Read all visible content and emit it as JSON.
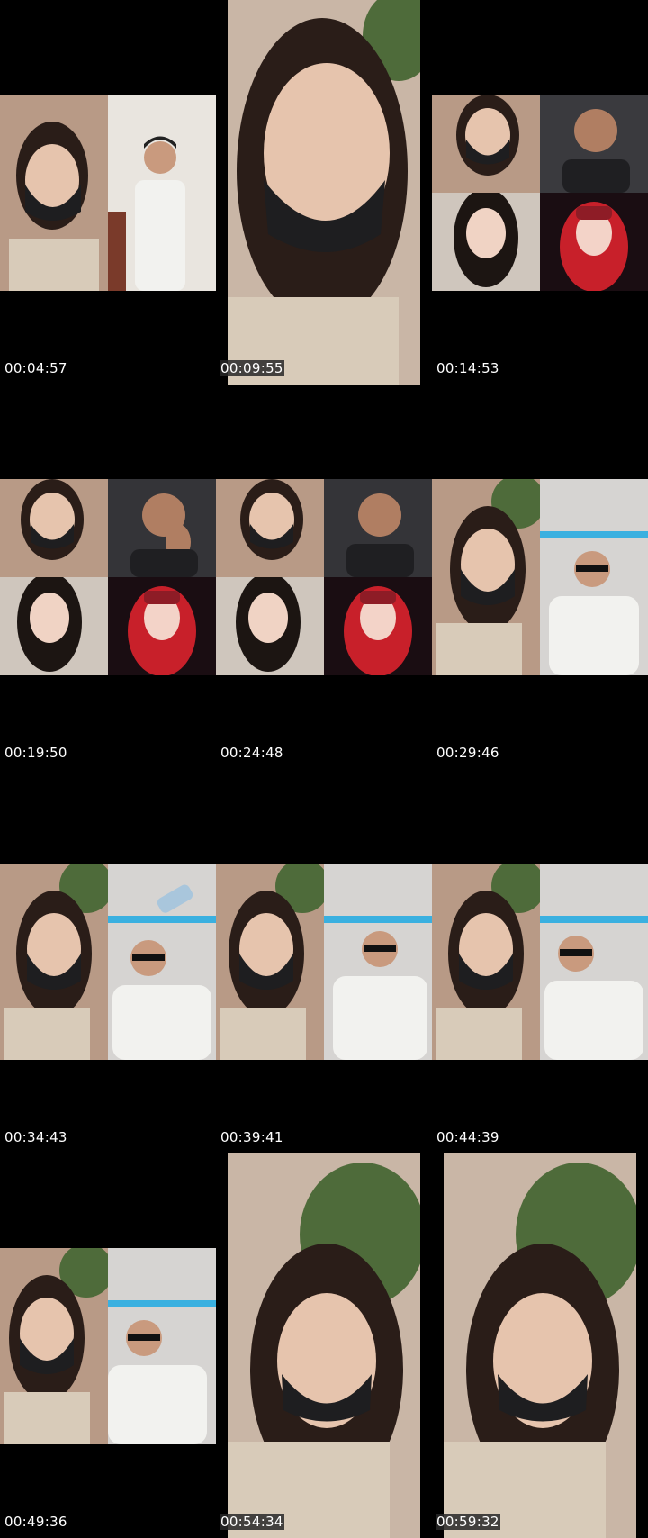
{
  "timestamps": [
    "00:04:57",
    "00:09:55",
    "00:14:53",
    "00:19:50",
    "00:24:48",
    "00:29:46",
    "00:34:43",
    "00:39:41",
    "00:44:39",
    "00:49:36",
    "00:54:34",
    "00:59:32"
  ],
  "colors": {
    "background": "#000000",
    "wall": "#c9b6a6",
    "mask": "#1e1e20",
    "hair": "#2a1d18",
    "skin": "#e6c4ad",
    "thobe": "#f2f2ef",
    "red_hair": "#c8202a",
    "plant": "#4e6b3a"
  }
}
